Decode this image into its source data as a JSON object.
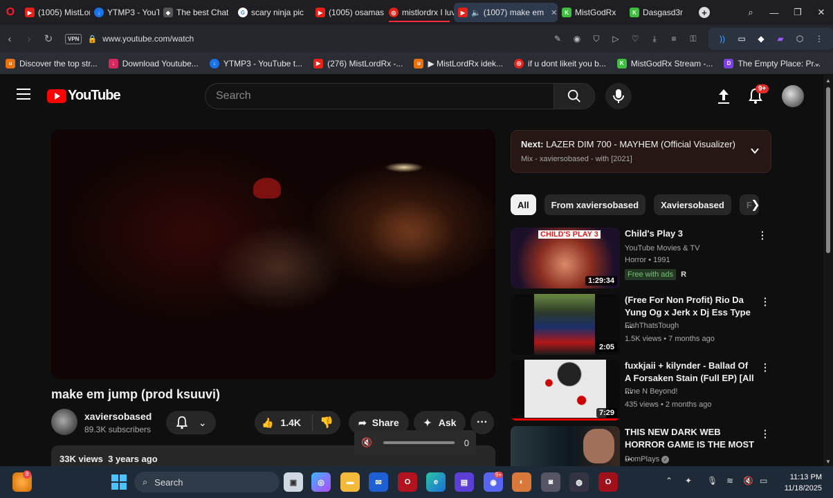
{
  "browser": {
    "tabs": [
      {
        "label": "(1005) MistLor",
        "fav_color": "#e62117"
      },
      {
        "label": "YTMP3 - YouT",
        "fav_color": "#1a73e8"
      },
      {
        "label": "The best Chat",
        "fav_color": "#dddddd"
      },
      {
        "label": "scary ninja pic",
        "fav_color": "#4285f4"
      },
      {
        "label": "(1005) osamas",
        "fav_color": "#e62117"
      },
      {
        "label": "mistlordrx I luv",
        "fav_color": "#e62117"
      },
      {
        "label": "(1007) make em",
        "fav_color": "#e62117",
        "active": true
      },
      {
        "label": "MistGodRx",
        "fav_color": "#3fbf3f"
      },
      {
        "label": "Dasgasd3r",
        "fav_color": "#3fbf3f"
      }
    ],
    "url": "www.youtube.com/watch",
    "vpn_label": "VPN",
    "bookmarks": [
      {
        "label": "Discover the top str...",
        "fav_color": "#e8710a"
      },
      {
        "label": "Download Youtube...",
        "fav_color": "#d6285c"
      },
      {
        "label": "YTMP3 - YouTube t...",
        "fav_color": "#1a73e8"
      },
      {
        "label": "(276) MistLordRx -...",
        "fav_color": "#e62117"
      },
      {
        "label": "▶ MistLordRx idek...",
        "fav_color": "#e8710a"
      },
      {
        "label": "if u dont likeit you b...",
        "fav_color": "#e62117"
      },
      {
        "label": "MistGodRx Stream -...",
        "fav_color": "#3fbf3f"
      },
      {
        "label": "The Empty Place: Pr...",
        "fav_color": "#7b3fe4"
      }
    ]
  },
  "youtube": {
    "logo_text": "YouTube",
    "search_placeholder": "Search",
    "notif_count": "9+",
    "video": {
      "title": "make em jump (prod ksuuvi)",
      "channel": "xaviersobased",
      "subscribers": "89.3K subscribers",
      "likes": "1.4K",
      "share_label": "Share",
      "ask_label": "Ask",
      "views": "33K views",
      "age": "3 years ago",
      "volume_value": "0"
    },
    "up_next": {
      "prefix": "Next:",
      "title": "LAZER DIM 700 - MAYHEM (Official Visualizer)",
      "subtitle": "Mix - xaviersobased - with [2021]"
    },
    "chips": [
      "All",
      "From xaviersobased",
      "Xaviersobased",
      "F"
    ],
    "recommendations": [
      {
        "title": "Child's Play 3",
        "line1": "YouTube Movies & TV",
        "line2": "Horror • 1991",
        "badge": "Free with ads",
        "rating": "R",
        "duration": "1:29:34",
        "thumb_label": "CHILD'S PLAY 3"
      },
      {
        "title": "(Free For Non Profit) Rio Da Yung Og x Jerk x Dj Ess Type ...",
        "line1": "FishThatsTough",
        "line2": "1.5K views • 7 months ago",
        "duration": "2:05"
      },
      {
        "title": "fuxkjaii + kilynder - Ballad Of A Forsaken Stain (Full EP) [All ...",
        "line1": "Pine N Beyond!",
        "line2": "435 views • 2 months ago",
        "duration": "7:29"
      },
      {
        "title": "THIS NEW DARK WEB HORROR GAME IS THE MOST ...",
        "line1": "DomPlays",
        "line2": ""
      }
    ]
  },
  "taskbar": {
    "search_label": "Search",
    "time": "11:13 PM",
    "date": "11/18/2025",
    "weather_badge": "8",
    "discord_badge": "9+"
  }
}
